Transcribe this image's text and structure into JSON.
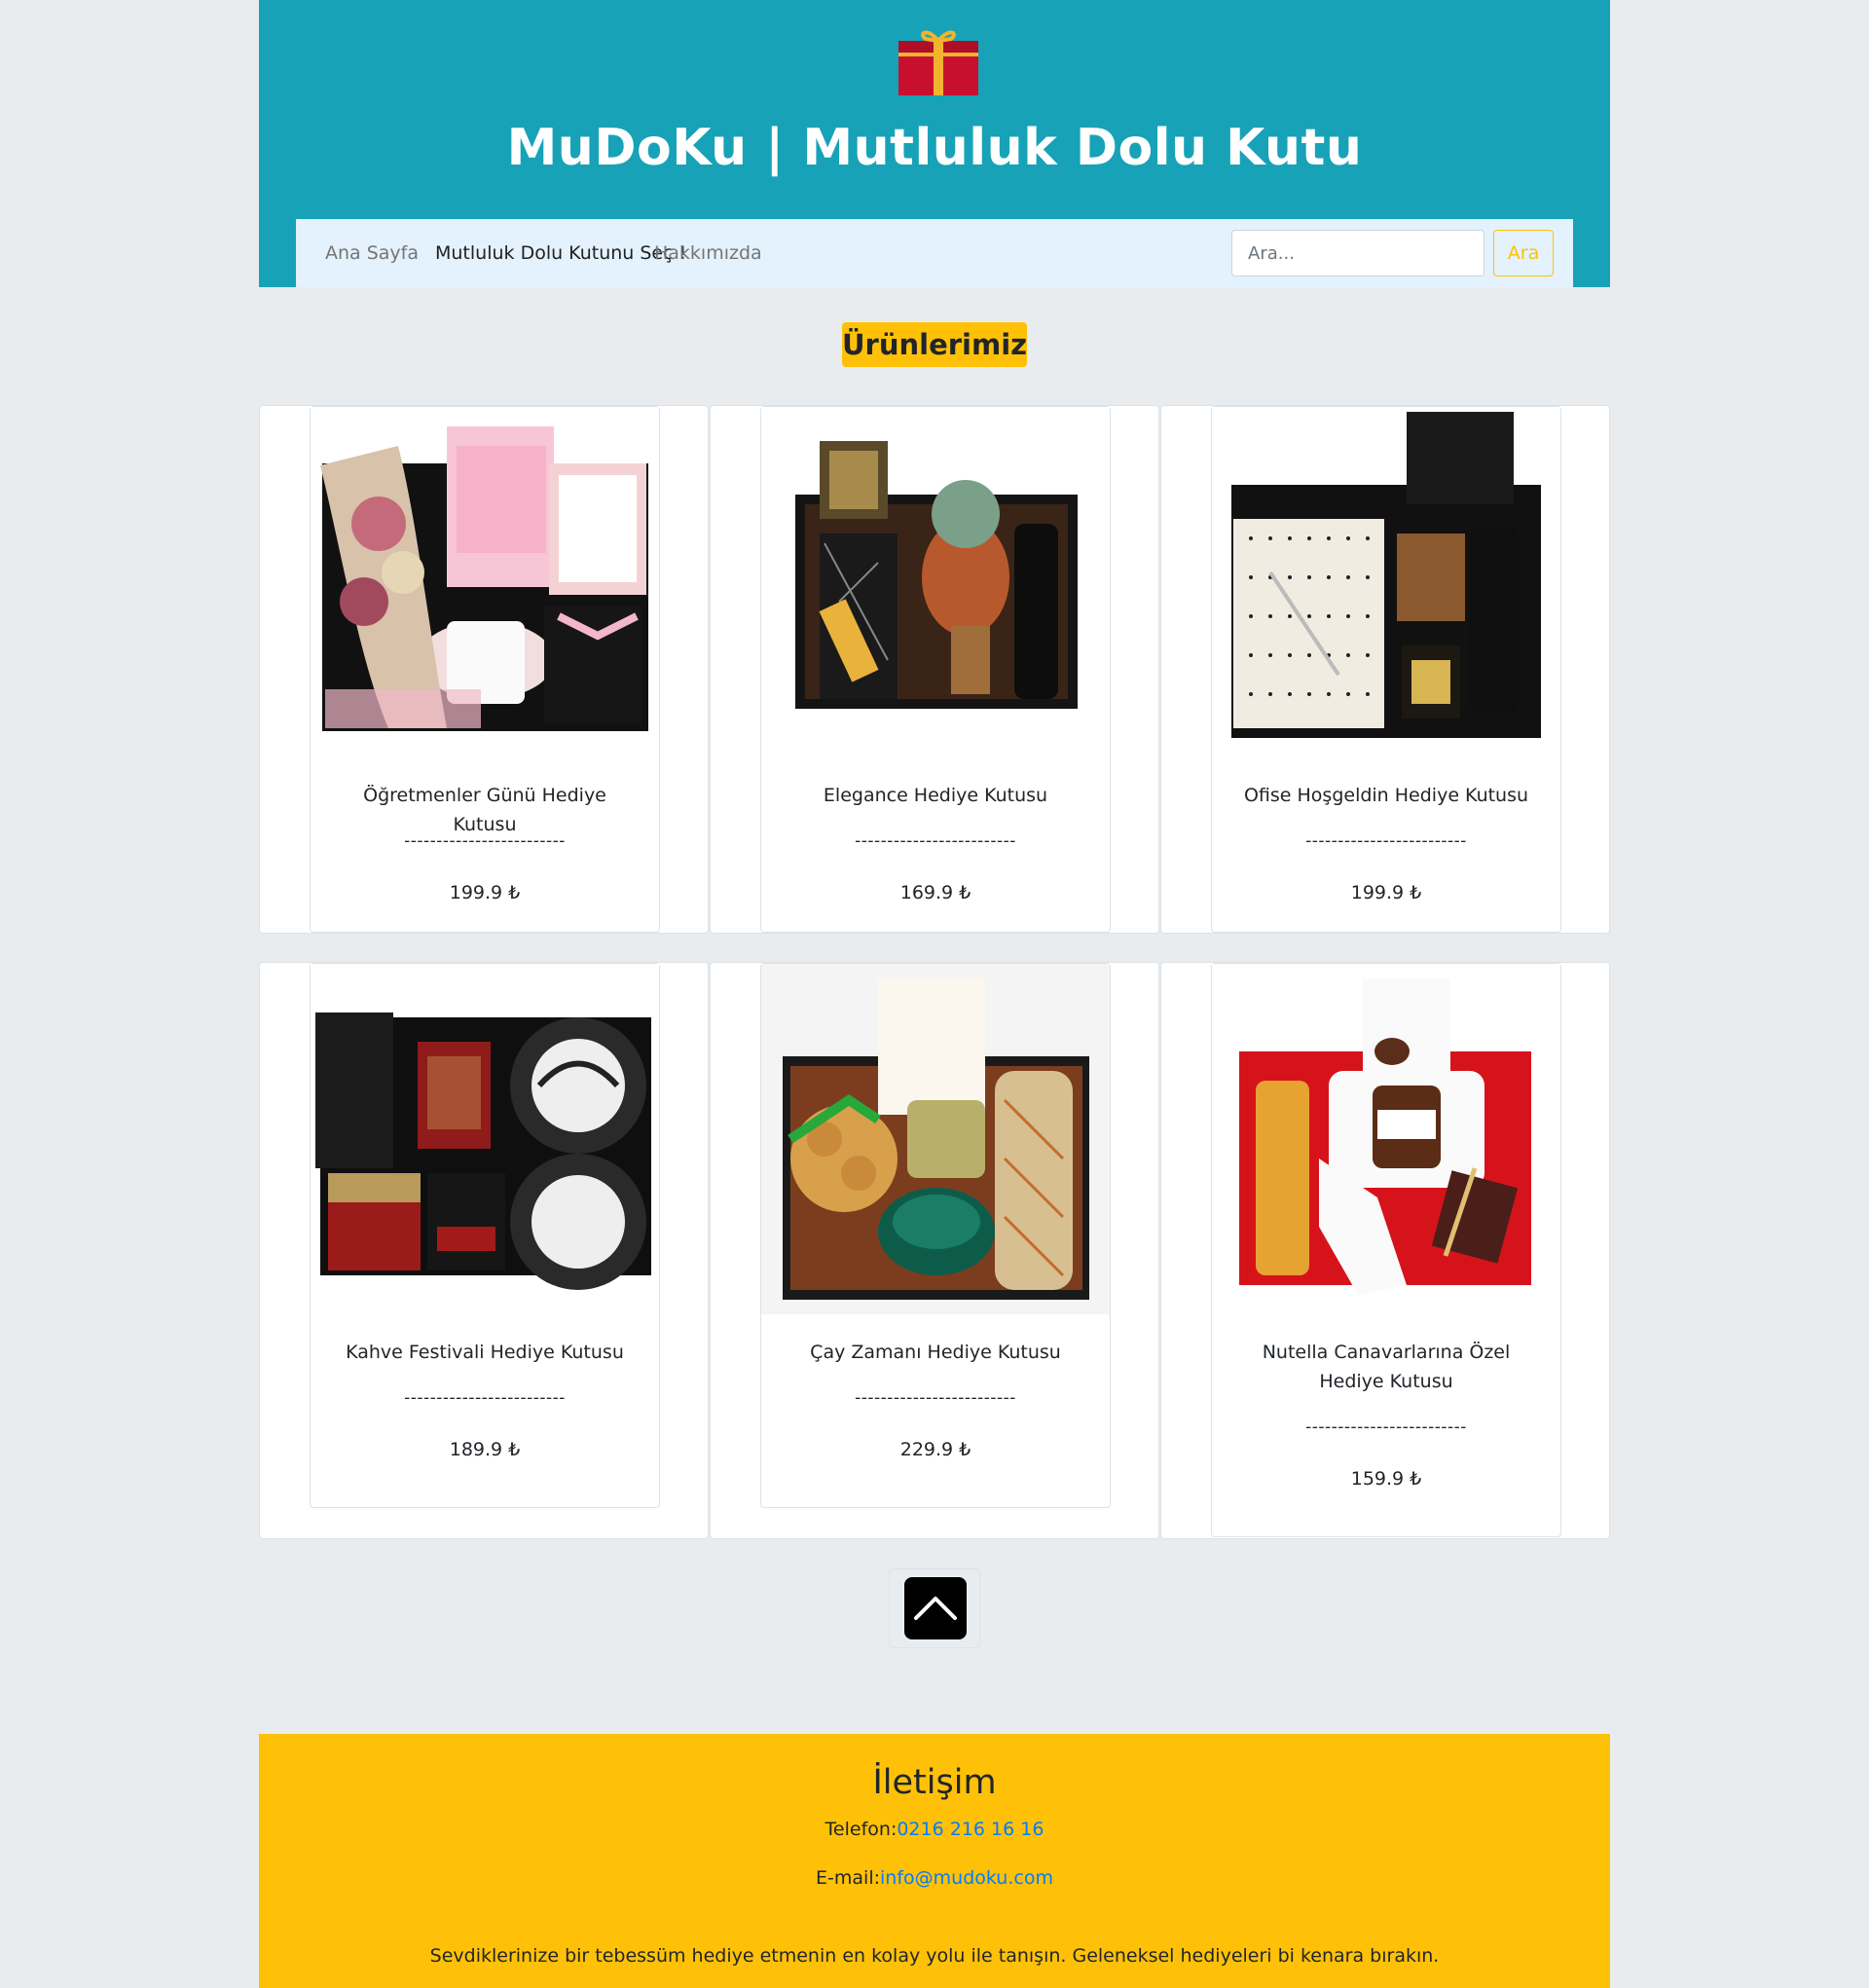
{
  "header": {
    "logo_icon": "gift-box-icon",
    "title": "MuDoKu | Mutluluk Dolu Kutu"
  },
  "nav": {
    "items": [
      {
        "label": "Ana Sayfa",
        "active": false
      },
      {
        "label": "Mutluluk Dolu Kutunu Seç !",
        "active": true
      },
      {
        "label": "Hakkımızda",
        "active": false
      }
    ],
    "search_placeholder": "Ara...",
    "search_button": "Ara"
  },
  "section_title": "Ürünlerimiz",
  "products": [
    {
      "name": "Öğretmenler Günü Hediye Kutusu",
      "separator": "-------------------------",
      "price": "199.9 ₺"
    },
    {
      "name": "Elegance Hediye Kutusu",
      "separator": "-------------------------",
      "price": "169.9 ₺"
    },
    {
      "name": "Ofise Hoşgeldin Hediye Kutusu",
      "separator": "-------------------------",
      "price": "199.9 ₺"
    },
    {
      "name": "Kahve Festivali Hediye Kutusu",
      "separator": "-------------------------",
      "price": "189.9 ₺"
    },
    {
      "name": "Çay Zamanı Hediye Kutusu",
      "separator": "-------------------------",
      "price": "229.9 ₺"
    },
    {
      "name": "Nutella Canavarlarına Özel Hediye Kutusu",
      "separator": "-------------------------",
      "price": "159.9 ₺"
    }
  ],
  "scroll_top_icon": "chevron-up-icon",
  "footer": {
    "title": "İletişim",
    "phone_label": "Telefon:",
    "phone_value": "0216 216 16 16",
    "email_label": "E-mail:",
    "email_value": "info@mudoku.com",
    "tagline": "Sevdiklerinize bir tebessüm hediye etmenin en kolay yolu ile tanışın. Geleneksel hediyeleri bi kenara bırakın."
  },
  "colors": {
    "header_bg": "#17a2b8",
    "navbar_bg": "#e3f2fd",
    "accent": "#ffc107",
    "link": "#007bff",
    "page_bg": "#e9ecef"
  }
}
